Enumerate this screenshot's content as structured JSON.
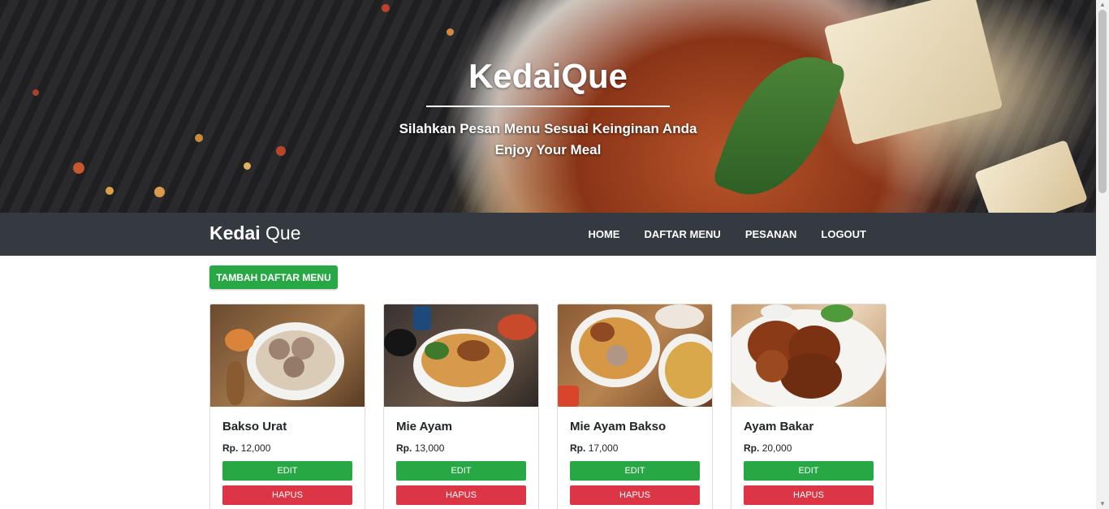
{
  "hero": {
    "title": "KedaiQue",
    "subtitle": "Silahkan Pesan Menu Sesuai Keinginan Anda",
    "tagline": "Enjoy Your Meal"
  },
  "navbar": {
    "brand_bold": "Kedai",
    "brand_light": " Que",
    "links": [
      {
        "label": "HOME"
      },
      {
        "label": "DAFTAR MENU"
      },
      {
        "label": "PESANAN"
      },
      {
        "label": "LOGOUT"
      }
    ]
  },
  "main": {
    "add_button": "TAMBAH DAFTAR MENU"
  },
  "menu_items": [
    {
      "name": "Bakso Urat",
      "price_label": "Rp.",
      "price": "12,000",
      "edit_label": "EDIT",
      "delete_label": "HAPUS"
    },
    {
      "name": "Mie Ayam",
      "price_label": "Rp.",
      "price": "13,000",
      "edit_label": "EDIT",
      "delete_label": "HAPUS"
    },
    {
      "name": "Mie Ayam Bakso",
      "price_label": "Rp.",
      "price": "17,000",
      "edit_label": "EDIT",
      "delete_label": "HAPUS"
    },
    {
      "name": "Ayam Bakar",
      "price_label": "Rp.",
      "price": "20,000",
      "edit_label": "EDIT",
      "delete_label": "HAPUS"
    }
  ],
  "colors": {
    "navbar": "#343a40",
    "success": "#28a745",
    "danger": "#dc3545"
  }
}
